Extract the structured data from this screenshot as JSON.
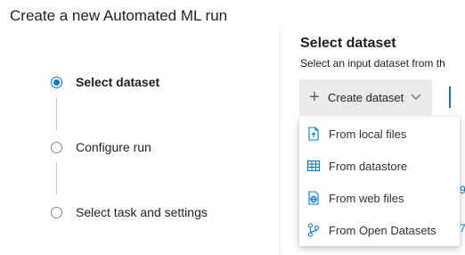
{
  "page": {
    "title": "Create a new Automated ML run"
  },
  "wizard": {
    "steps": [
      {
        "label": "Select dataset",
        "state": "active"
      },
      {
        "label": "Configure run",
        "state": "pending"
      },
      {
        "label": "Select task and settings",
        "state": "pending"
      }
    ]
  },
  "dataset": {
    "title": "Select dataset",
    "subtitle": "Select an input dataset from th",
    "create_button": {
      "label": "Create dataset",
      "icon": "plus-icon",
      "chevron": "chevron-down-icon"
    },
    "menu": [
      {
        "label": "From local files",
        "icon": "file-upload-icon"
      },
      {
        "label": "From datastore",
        "icon": "table-icon"
      },
      {
        "label": "From web files",
        "icon": "web-file-icon"
      },
      {
        "label": "From Open Datasets",
        "icon": "branch-icon"
      }
    ],
    "background_fragments": [
      "9",
      "7"
    ]
  },
  "colors": {
    "accent": "#0078d4",
    "button_bg": "#edebe9",
    "text": "#201f1e"
  }
}
